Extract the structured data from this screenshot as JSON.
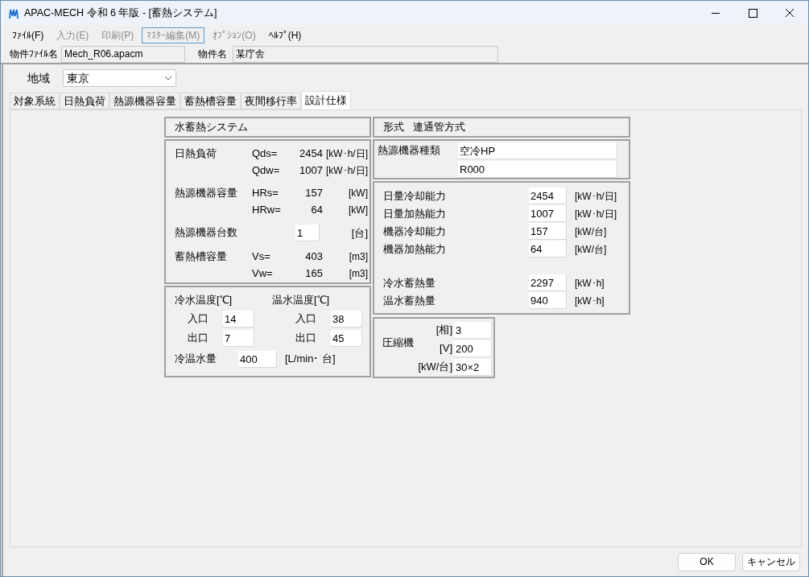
{
  "window": {
    "title": "APAC-MECH 令和 6 年版 - [蓄熱システム]"
  },
  "menu": [
    {
      "label": "ﾌｧｲﾙ(F)",
      "disabled": false,
      "selected": false
    },
    {
      "label": "入力(E)",
      "disabled": true,
      "selected": false
    },
    {
      "label": "印刷(P)",
      "disabled": true,
      "selected": false
    },
    {
      "label": "ﾏｽﾀｰ編集(M)",
      "disabled": true,
      "selected": true
    },
    {
      "label": "ｵﾌﾟｼｮﾝ(O)",
      "disabled": true,
      "selected": false
    },
    {
      "label": "ﾍﾙﾌﾟ(H)",
      "disabled": false,
      "selected": false
    }
  ],
  "project": {
    "file_label": "物件ﾌｧｲﾙ名",
    "file_value": "Mech_R06.apacm",
    "name_label": "物件名",
    "name_value": "某庁舎"
  },
  "region": {
    "label": "地域",
    "value": "東京"
  },
  "tabs": [
    {
      "label": "対象系統",
      "selected": false
    },
    {
      "label": "日熱負荷",
      "selected": false
    },
    {
      "label": "熱源機器容量",
      "selected": false
    },
    {
      "label": "蓄熱槽容量",
      "selected": false
    },
    {
      "label": "夜間移行率",
      "selected": false
    },
    {
      "label": "設計仕様",
      "selected": true
    }
  ],
  "system_title": "水蓄熱システム",
  "format": {
    "label": "形式",
    "value": "連通管方式"
  },
  "summary_groups": [
    {
      "label": "日熱負荷",
      "rows": [
        {
          "kind": "reading",
          "symbol": "Qds=",
          "value": "2454",
          "unit": "[kW･h/日]"
        },
        {
          "kind": "reading",
          "symbol": "Qdw=",
          "value": "1007",
          "unit": "[kW･h/日]"
        }
      ]
    },
    {
      "label": "熱源機器容量",
      "rows": [
        {
          "kind": "reading",
          "symbol": "HRs=",
          "value": "157",
          "unit": "[kW]"
        },
        {
          "kind": "reading",
          "symbol": "HRw=",
          "value": "64",
          "unit": "[kW]"
        }
      ]
    },
    {
      "label": "熱源機器台数",
      "rows": [
        {
          "kind": "input",
          "value": "1",
          "unit": "[台]"
        }
      ]
    },
    {
      "label": "蓄熱槽容量",
      "rows": [
        {
          "kind": "reading",
          "symbol": "Vs=",
          "value": "403",
          "unit": "[m3]"
        },
        {
          "kind": "reading",
          "symbol": "Vw=",
          "value": "165",
          "unit": "[m3]"
        }
      ]
    }
  ],
  "equipment_type": {
    "label": "熱源機器種類",
    "values": [
      "空冷HP",
      "R000"
    ]
  },
  "capacity_rows": [
    {
      "label": "日量冷却能力",
      "value": "2454",
      "unit": "[kW･h/日]"
    },
    {
      "label": "日量加熱能力",
      "value": "1007",
      "unit": "[kW･h/日]"
    },
    {
      "label": "機器冷却能力",
      "value": "157",
      "unit": "[kW/台]"
    },
    {
      "label": "機器加熱能力",
      "value": "64",
      "unit": "[kW/台]"
    }
  ],
  "storage_rows": [
    {
      "label": "冷水蓄熱量",
      "value": "2297",
      "unit": "[kW･h]"
    },
    {
      "label": "温水蓄熱量",
      "value": "940",
      "unit": "[kW･h]"
    }
  ],
  "temperatures": [
    {
      "title": "冷水温度[℃]",
      "rows": [
        {
          "label": "入口",
          "value": "14"
        },
        {
          "label": "出口",
          "value": "7"
        }
      ]
    },
    {
      "title": "温水温度[℃]",
      "rows": [
        {
          "label": "入口",
          "value": "38"
        },
        {
          "label": "出口",
          "value": "45"
        }
      ]
    }
  ],
  "flow": {
    "label": "冷温水量",
    "value": "400",
    "unit": "[L/min･ 台]"
  },
  "compressor": {
    "label": "圧縮機",
    "rows": [
      {
        "unit": "[相]",
        "value": "3"
      },
      {
        "unit": "[V]",
        "value": "200"
      },
      {
        "unit": "[kW/台]",
        "value": "30×2"
      }
    ]
  },
  "buttons": [
    "OK",
    "キャンセル"
  ]
}
